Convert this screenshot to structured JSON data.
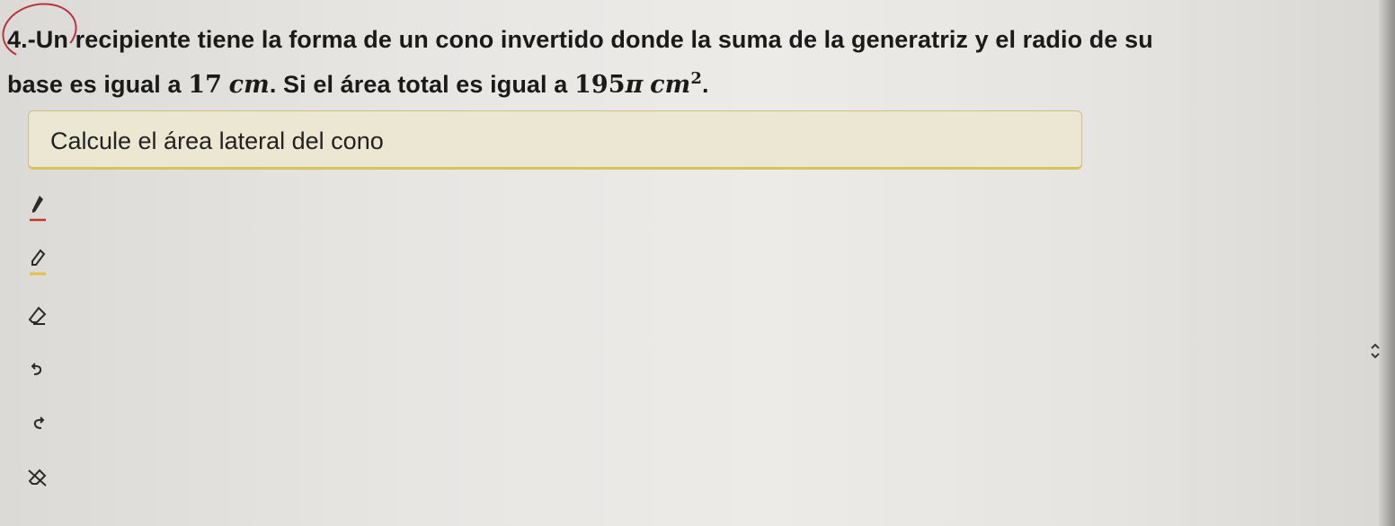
{
  "question": {
    "line1": "4.-Un recipiente tiene la forma de un cono invertido donde la suma de la generatriz y el radio de su",
    "line2_text1": "base es igual a ",
    "line2_num1": "17",
    "line2_unit1": "cm",
    "line2_text2": ". Si el área total es igual a ",
    "line2_num2": "195",
    "line2_pi": "π",
    "line2_unit2": "cm",
    "line2_exp": "2",
    "line2_end": "."
  },
  "prompt": {
    "text": "Calcule el área lateral del cono"
  },
  "toolbar": {
    "tools": [
      {
        "name": "pen-tool",
        "icon": "pen-icon"
      },
      {
        "name": "highlighter-tool",
        "icon": "highlighter-icon"
      },
      {
        "name": "eraser-tool",
        "icon": "eraser-icon"
      },
      {
        "name": "undo-tool",
        "icon": "undo-icon"
      },
      {
        "name": "redo-tool",
        "icon": "redo-icon"
      },
      {
        "name": "clear-tool",
        "icon": "clear-icon"
      }
    ]
  },
  "colors": {
    "pen_red": "#c0392b",
    "highlighter_yellow": "#e3c23b",
    "circle_mark": "#b8323c",
    "prompt_bg": "#ece7d2",
    "prompt_border": "#d8c25a"
  }
}
